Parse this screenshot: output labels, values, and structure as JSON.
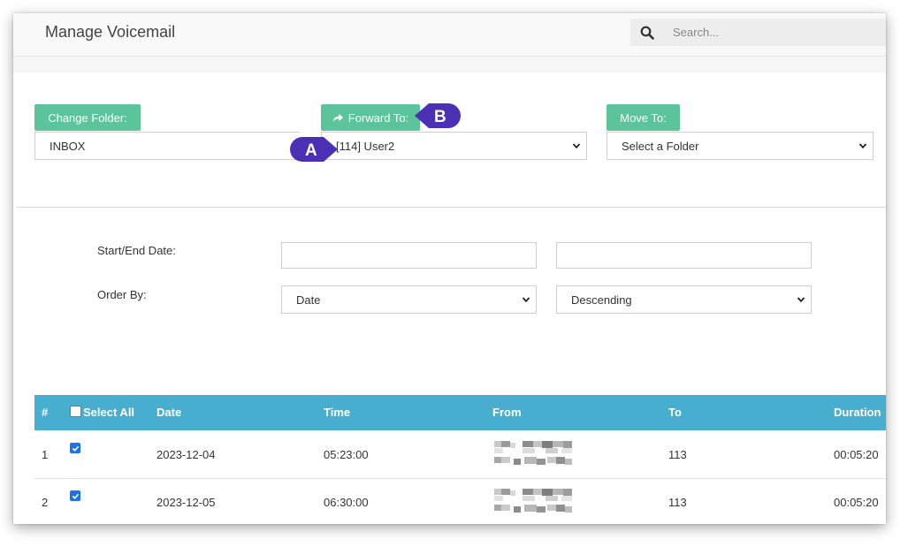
{
  "header": {
    "title": "Manage Voicemail",
    "search_placeholder": "Search..."
  },
  "toolbar": {
    "change_folder_label": "Change Folder:",
    "change_folder_value": "INBOX",
    "forward_label": "Forward To:",
    "forward_value": "[114] User2",
    "move_label": "Move To:",
    "move_value": "Select a Folder"
  },
  "callouts": {
    "a": "A",
    "b": "B"
  },
  "filters": {
    "date_label": "Start/End Date:",
    "start_date": "",
    "end_date": "",
    "order_label": "Order By:",
    "order_field": "Date",
    "order_direction": "Descending"
  },
  "table": {
    "columns": {
      "num": "#",
      "select_all": "Select All",
      "date": "Date",
      "time": "Time",
      "from": "From",
      "to": "To",
      "duration": "Duration"
    },
    "rows": [
      {
        "num": "1",
        "checked": true,
        "date": "2023-12-04",
        "time": "05:23:00",
        "to": "113",
        "duration": "00:05:20"
      },
      {
        "num": "2",
        "checked": true,
        "date": "2023-12-05",
        "time": "06:30:00",
        "to": "113",
        "duration": "00:05:20"
      }
    ]
  },
  "colors": {
    "accent_green": "#5cc49a",
    "table_header": "#48aed0",
    "callout_purple": "#4b2fb5"
  }
}
